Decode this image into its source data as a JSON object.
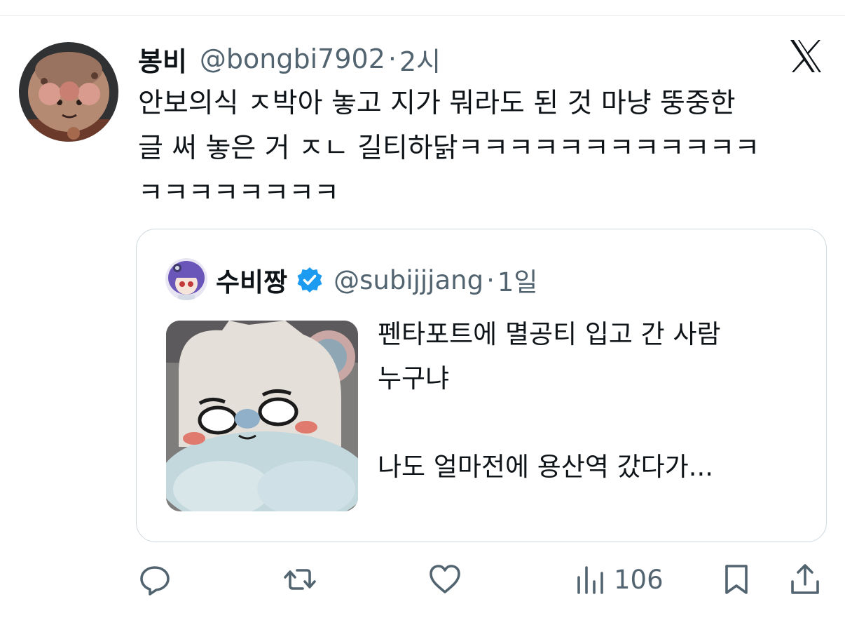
{
  "tweet": {
    "display_name": "봉비",
    "handle": "@bongbi7902",
    "separator": "·",
    "time": "2시",
    "text": "안보의식 ㅈ박아 놓고 지가 뭐라도 된 것 마냥 뚱중한\n글 써 놓은 거 ㅈㄴ 길티하닭ㅋㅋㅋㅋㅋㅋㅋㅋㅋㅋㅋㅋ\nㅋㅋㅋㅋㅋㅋㅋㅋ"
  },
  "quote": {
    "display_name": "수비짱",
    "handle": "@subijjjang",
    "separator": "·",
    "time": "1일",
    "text": "펜타포트에 멸공티 입고 간 사람\n누구냐\n\n나도 얼마전에 용산역 갔다가..."
  },
  "actions": {
    "views": "106"
  },
  "icons": {
    "brand_logo": "x-logo-icon",
    "reply": "reply-icon",
    "retweet": "retweet-icon",
    "like": "heart-icon",
    "views": "views-bar-chart-icon",
    "bookmark": "bookmark-icon",
    "share": "share-icon",
    "verified": "verified-badge-icon"
  },
  "colors": {
    "text_primary": "#0f1419",
    "text_secondary": "#536471",
    "border": "#cfd9de",
    "verified_blue": "#1d9bf0"
  }
}
